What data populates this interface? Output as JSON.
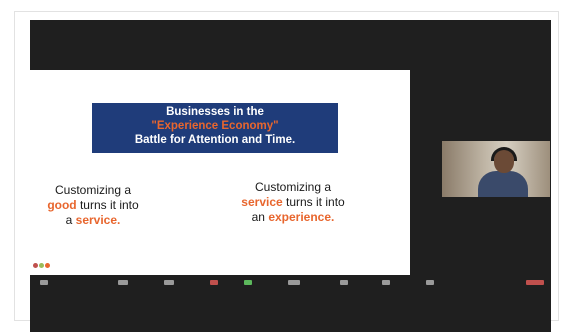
{
  "slide": {
    "title_line1": "Businesses in the",
    "title_line2": "\"Experience Economy\"",
    "title_line3": "Battle for Attention and Time.",
    "left": {
      "line1": "Customizing a",
      "word1": "good",
      "mid1": " turns it into",
      "pre2": "a ",
      "word2": "service."
    },
    "right": {
      "line1": "Customizing a",
      "word1": "service",
      "mid1": " turns it into",
      "pre2": "an ",
      "word2": "experience."
    },
    "indicator_colors": [
      "#c0504d",
      "#9bbb59",
      "#e8662e"
    ]
  },
  "participant": {
    "name": ""
  },
  "colors": {
    "accent": "#e8662e",
    "title_bg": "#1f3c7a",
    "meeting_bg": "#1f1f1f"
  },
  "toolbar": {
    "icons": [
      "mute-icon",
      "video-icon",
      "security-icon",
      "participants-icon",
      "chat-icon",
      "share-screen-icon",
      "record-icon",
      "reactions-icon",
      "more-icon",
      "end-icon"
    ]
  }
}
